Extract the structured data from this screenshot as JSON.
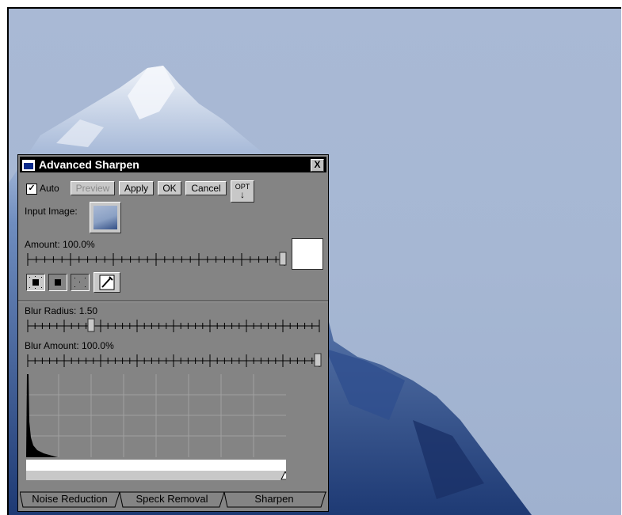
{
  "dialog": {
    "title": "Advanced Sharpen",
    "close_label": "X",
    "auto_label": "Auto",
    "auto_checked": true,
    "buttons": {
      "preview": "Preview",
      "apply": "Apply",
      "ok": "OK",
      "cancel": "Cancel",
      "opt": "OPT"
    },
    "input_image_label": "Input Image:",
    "amount_label": "Amount: 100.0%",
    "blur_radius_label": "Blur Radius: 1.50",
    "blur_amount_label": "Blur Amount: 100.0%",
    "tabs": [
      "Noise Reduction",
      "Speck Removal",
      "Sharpen"
    ]
  },
  "sliders": {
    "amount_percent": 100.0,
    "blur_radius": 1.5,
    "blur_amount_percent": 100.0
  },
  "colors": {
    "dialog_bg": "#848484",
    "titlebar": "#000000",
    "sky": "#a9b9d5",
    "mountain_dark": "#213e78"
  }
}
